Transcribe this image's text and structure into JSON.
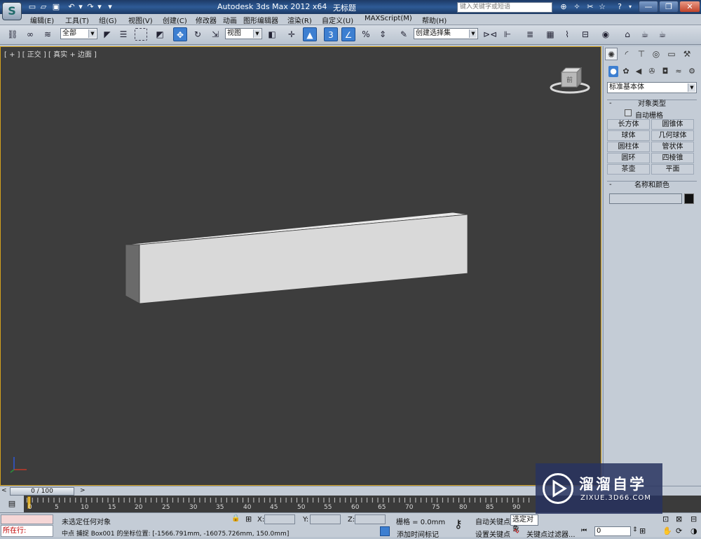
{
  "window": {
    "title": "Autodesk 3ds Max  2012 x64",
    "file": "无标题",
    "search_placeholder": "键入关键字或短语"
  },
  "menu": [
    "编辑(E)",
    "工具(T)",
    "组(G)",
    "视图(V)",
    "创建(C)",
    "修改器",
    "动画",
    "图形编辑器",
    "渲染(R)",
    "自定义(U)",
    "MAXScript(M)",
    "帮助(H)"
  ],
  "toolbar": {
    "selection_filter": "全部",
    "ref_coord": "视图",
    "named_selection": "创建选择集"
  },
  "viewport": {
    "label": "[ + ] [ 正交 ] [ 真实 + 边面 ]",
    "viewcube_face": "前"
  },
  "command_panel": {
    "category": "标准基本体",
    "object_type_header": "对象类型",
    "autogrid_label": "自动栅格",
    "objects": [
      "长方体",
      "圆锥体",
      "球体",
      "几何球体",
      "圆柱体",
      "管状体",
      "圆环",
      "四棱锥",
      "茶壶",
      "平面"
    ],
    "name_color_header": "名称和颜色",
    "object_color": "#111111"
  },
  "time": {
    "slider_value": "0 / 100",
    "ticks": [
      "0",
      "5",
      "10",
      "15",
      "20",
      "25",
      "30",
      "35",
      "40",
      "45",
      "50",
      "55",
      "60",
      "65",
      "70",
      "75",
      "80",
      "85",
      "90"
    ]
  },
  "status": {
    "script_label": "所在行:",
    "selection_info": "未选定任何对象",
    "prompt": "中点 捕捉 Box001 的坐标位置: [-1566.791mm, -16075.726mm, 150.0mm]",
    "x_label": "X:",
    "y_label": "Y:",
    "z_label": "Z:",
    "grid": "栅格 = 0.0mm",
    "add_time_tag": "添加时间标记",
    "auto_key": "自动关键点",
    "auto_key_value": "选定对象",
    "set_key": "设置关键点",
    "key_filters": "关键点过滤器...",
    "frame_value": "0"
  },
  "watermark": {
    "title": "溜溜自学",
    "subtitle": "ZIXUE.3D66.COM"
  },
  "colors": {
    "viewport_bg": "#3d3d3d",
    "viewport_border": "#d5a21d",
    "ui_bg": "#c4ccd6",
    "active_blue": "#3d7fd1",
    "title_bar": "#2e5b96"
  }
}
